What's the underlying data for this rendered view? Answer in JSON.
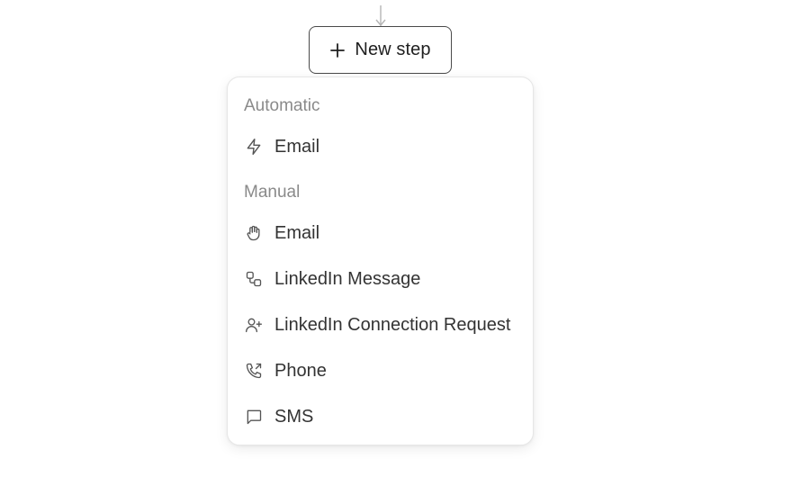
{
  "new_step_button": {
    "label": "New step",
    "icon": "plus-icon"
  },
  "menu": {
    "sections": [
      {
        "label": "Automatic",
        "items": [
          {
            "label": "Email",
            "icon": "lightning-icon"
          }
        ]
      },
      {
        "label": "Manual",
        "items": [
          {
            "label": "Email",
            "icon": "hand-icon"
          },
          {
            "label": "LinkedIn Message",
            "icon": "linked-squares-icon"
          },
          {
            "label": "LinkedIn Connection Request",
            "icon": "user-plus-icon"
          },
          {
            "label": "Phone",
            "icon": "phone-outgoing-icon"
          },
          {
            "label": "SMS",
            "icon": "chat-bubble-icon"
          }
        ]
      }
    ]
  },
  "colors": {
    "text": "#333333",
    "section_label": "#8a8a8a",
    "border": "#e6e6e6",
    "button_border": "#4a4a4a"
  }
}
